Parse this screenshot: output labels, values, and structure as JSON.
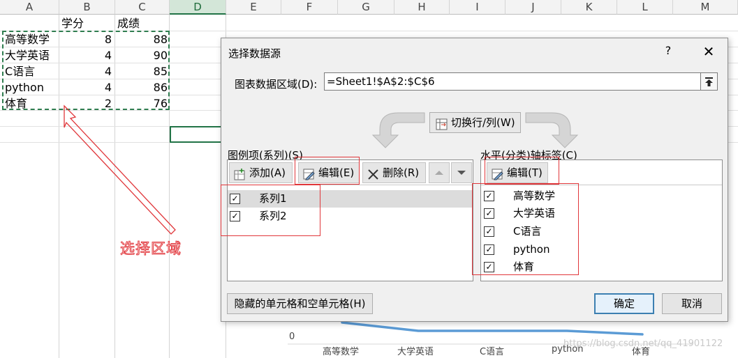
{
  "sheet": {
    "columns": [
      "A",
      "B",
      "C",
      "D",
      "E",
      "F",
      "G",
      "H",
      "I",
      "J",
      "K",
      "L",
      "M"
    ],
    "header_row": {
      "b": "学分",
      "c": "成绩"
    },
    "rows": [
      {
        "a": "高等数学",
        "b": "8",
        "c": "88"
      },
      {
        "a": "大学英语",
        "b": "4",
        "c": "90"
      },
      {
        "a": "C语言",
        "b": "4",
        "c": "85"
      },
      {
        "a": "python",
        "b": "4",
        "c": "86"
      },
      {
        "a": "体育",
        "b": "2",
        "c": "76"
      }
    ]
  },
  "annotation": {
    "text": "选择区域",
    "color": "#e23b40"
  },
  "chart": {
    "y_tick": "0",
    "categories": [
      "高等数学",
      "大学英语",
      "C语言",
      "python",
      "体育"
    ],
    "line_color": "#5b9bd5"
  },
  "watermark": "https://blog.csdn.net/qq_41901122",
  "dialog": {
    "title": "选择数据源",
    "help": "?",
    "close": "✕",
    "range_label": "图表数据区域(D):",
    "range_value": "=Sheet1!$A$2:$C$6",
    "switch_label": "切换行/列(W)",
    "legend_label": "图例项(系列)(S)",
    "add_label": "添加(A)",
    "edit_label": "编辑(E)",
    "delete_label": "删除(R)",
    "series": [
      "系列1",
      "系列2"
    ],
    "axis_label": "水平(分类)轴标签(C)",
    "axis_edit_label": "编辑(T)",
    "categories": [
      "高等数学",
      "大学英语",
      "C语言",
      "python",
      "体育"
    ],
    "hidden_cells_label": "隐藏的单元格和空单元格(H)",
    "ok_label": "确定",
    "cancel_label": "取消"
  },
  "colors": {
    "excel_green": "#217346",
    "annotation_red": "#e0363a",
    "ok_border": "#3c7fb1"
  }
}
